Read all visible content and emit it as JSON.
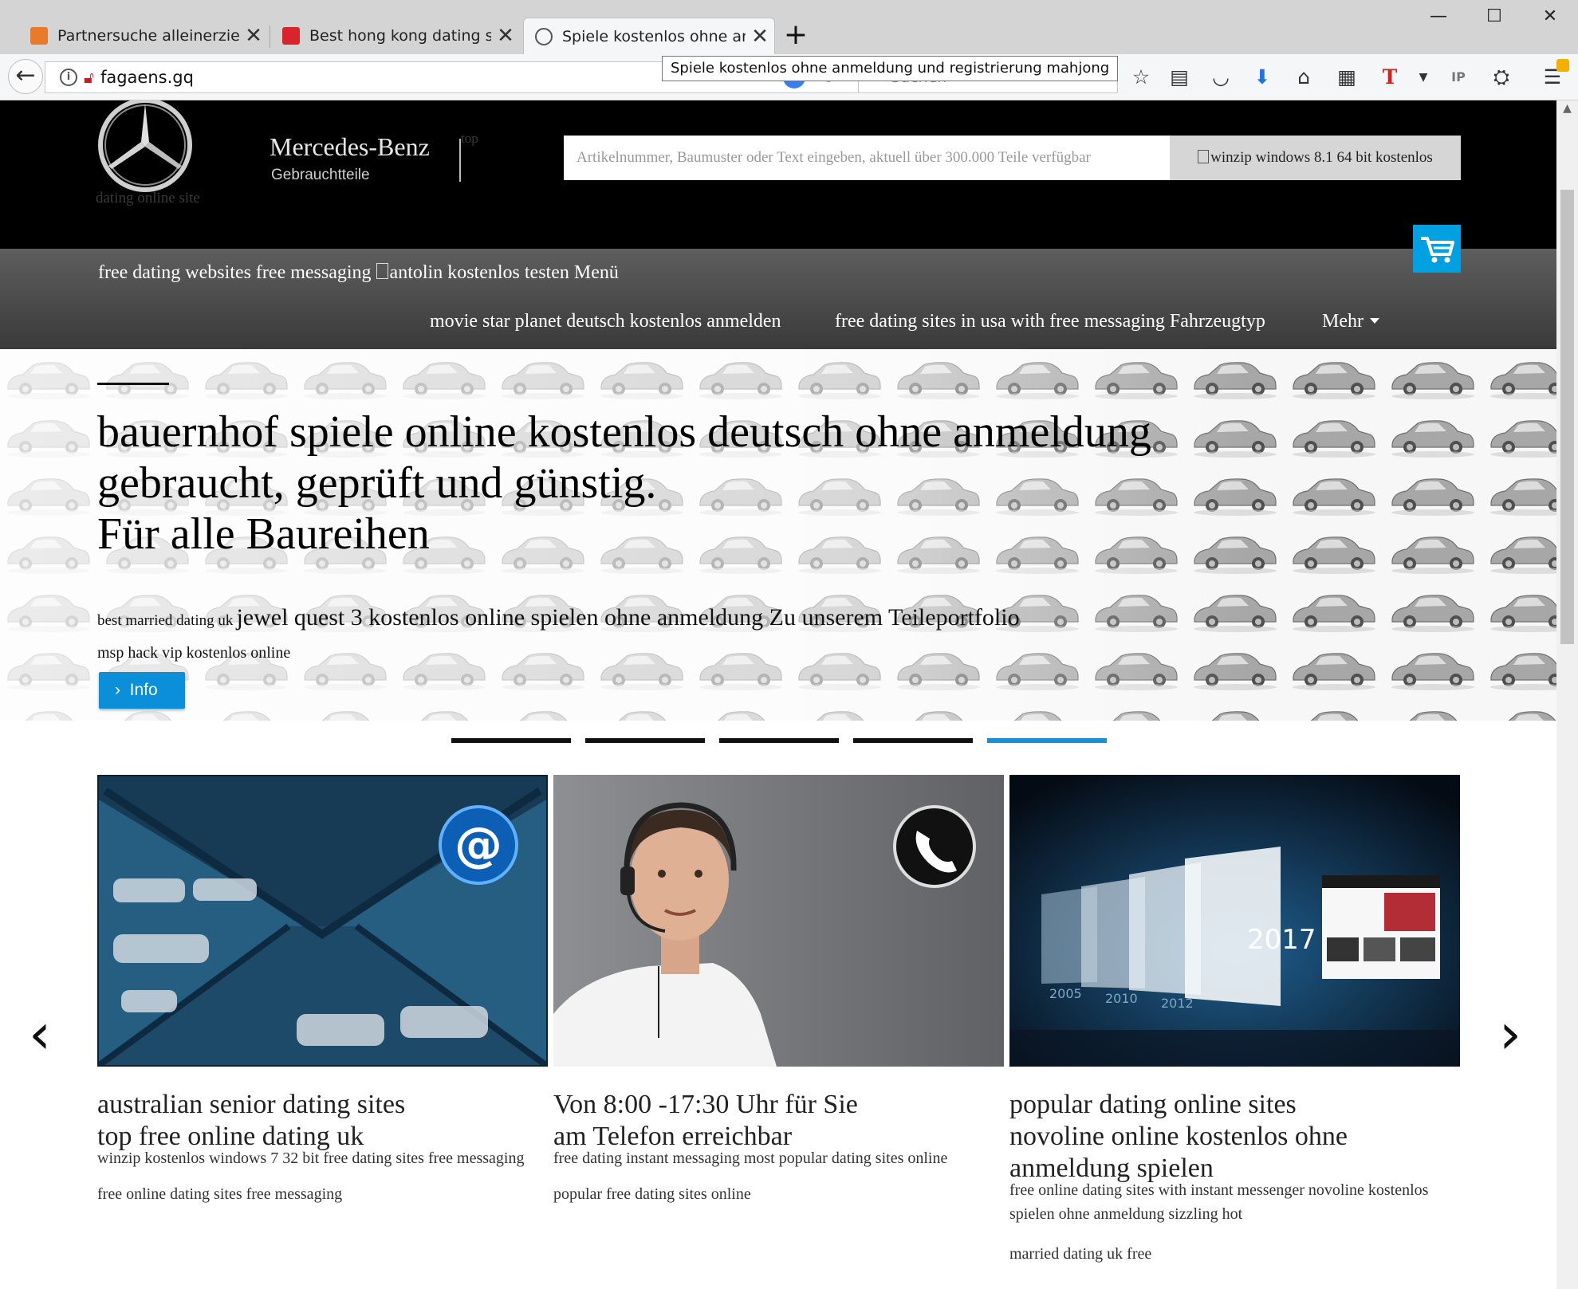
{
  "browser": {
    "tabs": [
      {
        "title": "Partnersuche alleinerziehend",
        "active": false
      },
      {
        "title": "Best hong kong dating site",
        "active": false
      },
      {
        "title": "Spiele kostenlos ohne anmeldung",
        "active": true
      }
    ],
    "new_tab_label": "+",
    "window_controls": {
      "minimize": "—",
      "maximize": "☐",
      "close": "✕"
    },
    "url": "fagaens.gq",
    "search_placeholder": "Suchen",
    "tooltip": "Spiele kostenlos ohne anmeldung und registrierung mahjong",
    "toolbar_icons": [
      "bookmark-star-icon",
      "reader-list-icon",
      "pocket-icon",
      "download-icon",
      "home-icon",
      "qr-code-icon",
      "text-t-icon",
      "dropdown-icon",
      "ip-icon",
      "network-icon",
      "menu-icon"
    ]
  },
  "site": {
    "logo_sub": "dating online site",
    "brand_name": "Mercedes-Benz",
    "brand_sub": "Gebrauchtteile",
    "top_link": "top",
    "search_placeholder": "Artikelnummer, Baumuster oder Text eingeben, aktuell über 300.000 Teile verfügbar",
    "search_button": "winzip windows 8.1 64 bit kostenlos",
    "menu_top_left": "free dating websites free messaging",
    "menu_top_right": "antolin kostenlos testen Menü",
    "menu_items": [
      "movie star planet deutsch kostenlos anmelden",
      "free dating sites in usa with free messaging Fahrzeugtyp",
      "Mehr"
    ],
    "colors": {
      "accent": "#00a0e1",
      "header_bg": "#000000",
      "menubar": "#4a4a4a"
    }
  },
  "hero": {
    "title_line1": "bauernhof spiele online kostenlos deutsch ohne anmeldung",
    "title_line2": "gebraucht, geprüft und günstig.",
    "title_line3": "Für alle Baureihen",
    "small_text": "best married dating uk",
    "large_text": "jewel quest 3 kostenlos online spielen ohne anmeldung Zu unserem Teileportfolio",
    "msp_text": "msp hack vip kostenlos online",
    "info_button": "Info",
    "slide_count": 5,
    "active_slide": 5
  },
  "cards": [
    {
      "title_line1": "australian senior dating sites",
      "title_line2": "top free online dating uk",
      "text1": "winzip kostenlos windows 7 32 bit free dating sites free messaging",
      "text2": "free online dating sites free messaging"
    },
    {
      "title_line1": "Von 8:00 -17:30 Uhr für Sie",
      "title_line2": "am Telefon erreichbar",
      "text1": "free dating instant messaging most popular dating sites online",
      "text2": "popular free dating sites online"
    },
    {
      "title_line1": "popular dating online sites",
      "title_line2": "novoline online kostenlos ohne",
      "title_line3": "anmeldung spielen",
      "text1": "free online dating sites with instant messenger novoline kostenlos spielen ohne anmeldung sizzling hot",
      "text2": "married dating uk free"
    }
  ],
  "card_image_labels": {
    "year": "2017",
    "years": [
      "2005",
      "2010",
      "2012"
    ]
  },
  "slider": {
    "prev": "‹",
    "next": "›"
  }
}
